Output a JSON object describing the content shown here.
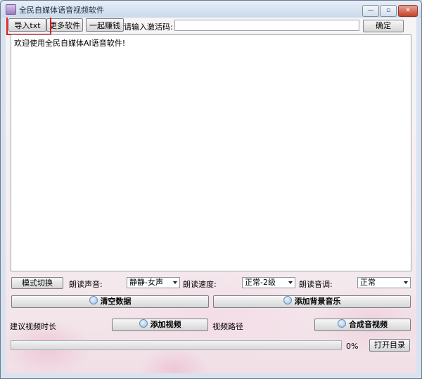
{
  "window": {
    "title": "全民自媒体语音视频软件",
    "controls": {
      "minimize": "—",
      "restore": "▫",
      "close": "✕"
    }
  },
  "toolbar": {
    "import_txt": "导入txt",
    "more_software": "更多软件",
    "earn_together": "一起赚钱",
    "activation_label": "请输入激活码:",
    "activation_value": "",
    "confirm": "确定"
  },
  "editor": {
    "content": "欢迎使用全民自媒体AI语音软件!"
  },
  "settings": {
    "mode_switch": "模式切换",
    "voice_label": "朗读声音:",
    "voice_selected": "静静-女声",
    "speed_label": "朗读速度:",
    "speed_selected": "正常-2级",
    "pitch_label": "朗读音调:",
    "pitch_selected": "正常"
  },
  "actions": {
    "clear_data": "清空数据",
    "add_bgm": "添加背景音乐",
    "suggest_duration": "建议视频时长",
    "add_video": "添加视频",
    "video_path": "视频路径",
    "compose": "合成音视频"
  },
  "progress": {
    "value": 0,
    "label": "0%",
    "open_dir": "打开目录",
    "fill_color": "#5fbf4c"
  },
  "annotation": {
    "highlight_color": "#e0151b"
  }
}
